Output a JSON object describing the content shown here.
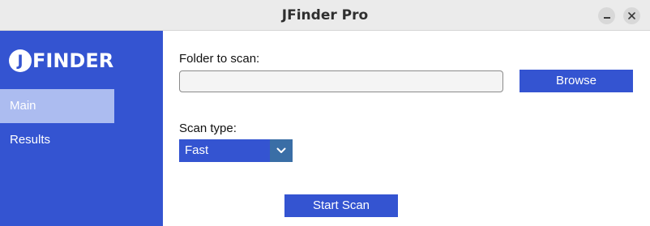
{
  "window": {
    "title": "JFinder Pro"
  },
  "sidebar": {
    "logo": {
      "mark": "J",
      "text": "FINDER"
    },
    "items": [
      {
        "label": "Main",
        "active": true
      },
      {
        "label": "Results",
        "active": false
      }
    ]
  },
  "main": {
    "folder_label": "Folder to scan:",
    "folder_value": "",
    "browse_label": "Browse",
    "scan_type_label": "Scan type:",
    "scan_type_value": "Fast",
    "start_label": "Start Scan"
  },
  "colors": {
    "accent": "#3454d1",
    "sidebar_active": "#acbcf0",
    "select_arrow_bg": "#3a6ea6"
  },
  "icons": {
    "minimize": "minimize-icon",
    "maximize": "maximize-icon",
    "close": "close-icon",
    "dropdown": "chevron-down-icon"
  }
}
